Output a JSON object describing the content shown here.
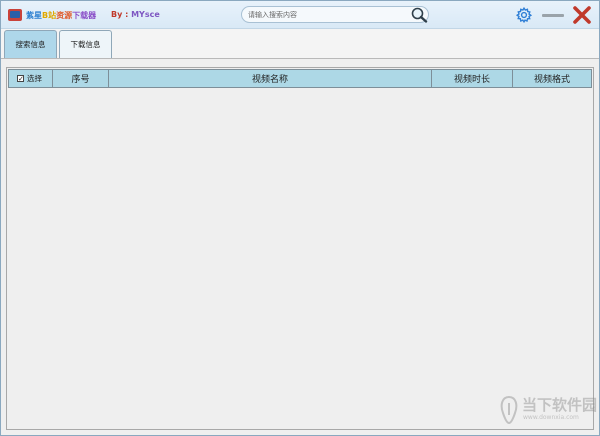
{
  "titlebar": {
    "title_parts": [
      "紫星",
      "B站",
      "资源",
      "下载器"
    ],
    "author_prefix": "By : ",
    "author_name": "MYsce",
    "search_placeholder": "请输入搜索内容"
  },
  "tabs": [
    {
      "label": "搜索信息",
      "active": true
    },
    {
      "label": "下载信息",
      "active": false
    }
  ],
  "table": {
    "select_label": "选择",
    "select_checked": true,
    "columns": [
      "序号",
      "视频名称",
      "视频时长",
      "视频格式"
    ],
    "rows": []
  },
  "watermark": {
    "text": "当下软件园",
    "url": "www.downxia.com"
  },
  "colors": {
    "header_bg": "#add8e6",
    "active_tab": "#aed7ea",
    "close": "#c0392b"
  }
}
